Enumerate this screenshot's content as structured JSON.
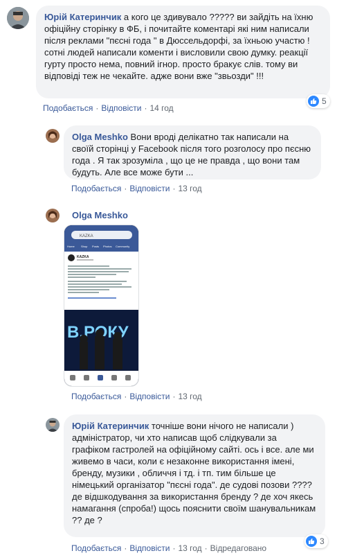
{
  "comments": [
    {
      "author": "Юрій Катеринчик",
      "text": " а кого це здивувало ????? ви зайдіть на їхню офіційну сторінку в ФБ, і почитайте коментарі які ним написали після реклами \"пєсні года \" в Дюссельдорфі, за їхньою участю ! сотні людей написали коменти і висловили свою думку. реакції гурту просто нема, повний ігнор. просто бракує слів. тому ви відповіді теж не чекайте. адже вони вже \"звьозди\" !!!",
      "like": "Подобається",
      "reply": "Відповісти",
      "time": "14 год",
      "reactions": "5"
    },
    {
      "author": "Olga Meshko",
      "text": " Вони вроді делікатно так написали на своїй сторінці у Facebook після того розголосу про пєсню года . Я так зрозуміла , що це не правда , що вони там будуть. Але все може бути ...",
      "like": "Подобається",
      "reply": "Відповісти",
      "time": "13 год"
    },
    {
      "author": "Olga Meshko",
      "like": "Подобається",
      "reply": "Відповісти",
      "time": "13 год",
      "screenshot": {
        "tabs": [
          "Home",
          "Shop",
          "Posts",
          "Photos",
          "Community"
        ],
        "search": "KAZKA",
        "page_name": "KAZKA",
        "banner_text": "В.РОКУ"
      }
    },
    {
      "author": "Юрій Катеринчик",
      "text": " точніше вони нічого не написали ) адміністратор, чи хто написав щоб слідкували за графіком гастролей на офіційному сайті. ось і все. але ми живемо в часи, коли є незаконне використання імені, бренду, музики , обличчя і тд. і тп. тим більше це німецький організатор \"пєсні года\". де судові позови ???? де відшкодування за використання бренду ? де хоч якесь намагання (спроба!) щось пояснити своїм шанувальникам ?? де ?",
      "like": "Подобається",
      "reply": "Відповісти",
      "time": "13 год",
      "edited": "Відредаговано",
      "reactions": "3"
    }
  ],
  "colors": {
    "link": "#385898",
    "bubble": "#f2f3f5",
    "meta": "#606770",
    "like": "#2d88ff"
  }
}
